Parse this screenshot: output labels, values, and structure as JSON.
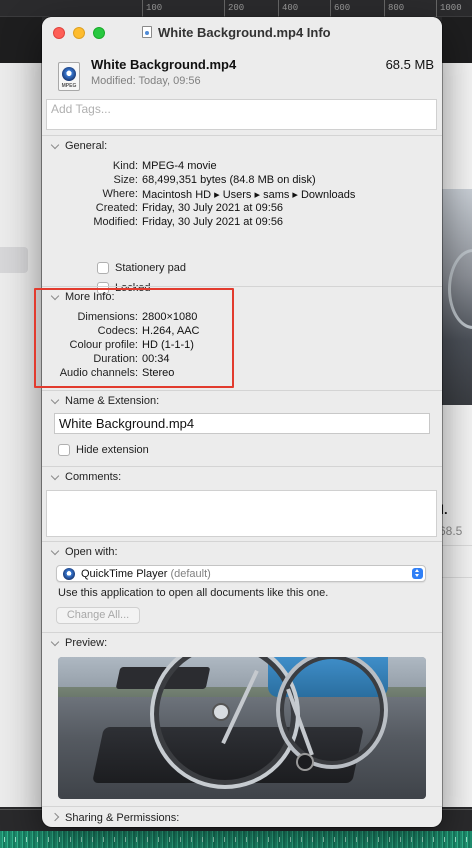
{
  "ruler": {
    "labels": [
      "100",
      "200",
      "400",
      "600",
      "800",
      "1000"
    ]
  },
  "window": {
    "title": "White Background.mp4 Info"
  },
  "header": {
    "file_icon_label": "MPEG",
    "name": "White Background.mp4",
    "size": "68.5 MB",
    "modified": "Modified: Today, 09:56",
    "tags_placeholder": "Add Tags..."
  },
  "general": {
    "heading": "General:",
    "rows": [
      {
        "key": "Kind:",
        "value": "MPEG-4 movie"
      },
      {
        "key": "Size:",
        "value": "68,499,351 bytes (84.8 MB on disk)"
      },
      {
        "key": "Where:",
        "value": "Macintosh HD ▸ Users ▸ sams ▸ Downloads"
      },
      {
        "key": "Created:",
        "value": "Friday, 30 July 2021 at 09:56"
      },
      {
        "key": "Modified:",
        "value": "Friday, 30 July 2021 at 09:56"
      }
    ],
    "stationery_label": "Stationery pad",
    "stationery_checked": false,
    "locked_label": "Locked",
    "locked_checked": false
  },
  "more_info": {
    "heading": "More Info:",
    "rows": [
      {
        "key": "Dimensions:",
        "value": "2800×1080"
      },
      {
        "key": "Codecs:",
        "value": "H.264, AAC"
      },
      {
        "key": "Colour profile:",
        "value": "HD (1-1-1)"
      },
      {
        "key": "Duration:",
        "value": "00:34"
      },
      {
        "key": "Audio channels:",
        "value": "Stereo"
      }
    ],
    "highlight_color": "#e23b2e"
  },
  "name_ext": {
    "heading": "Name & Extension:",
    "value": "White Background.mp4",
    "hide_extension_label": "Hide extension",
    "hide_extension_checked": false
  },
  "comments": {
    "heading": "Comments:",
    "value": ""
  },
  "open_with": {
    "heading": "Open with:",
    "app": "QuickTime Player",
    "default_suffix": "(default)",
    "hint": "Use this application to open all documents like this one.",
    "change_all_label": "Change All..."
  },
  "preview": {
    "heading": "Preview:"
  },
  "sharing": {
    "heading": "Sharing & Permissions:"
  },
  "background": {
    "file_name_fragment": "d.",
    "file_size_fragment": "68.5"
  },
  "colors": {
    "accent": "#2f7ff6",
    "close": "#fe5f57",
    "minimize": "#febc2e",
    "zoom": "#28c840"
  }
}
